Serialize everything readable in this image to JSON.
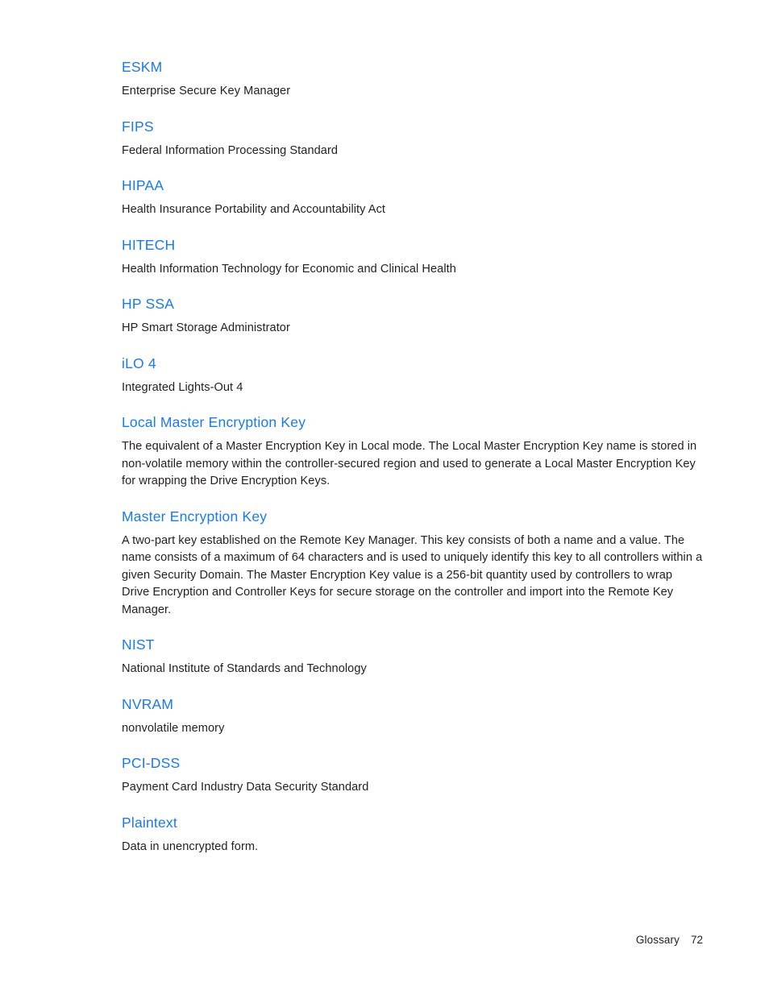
{
  "document": {
    "section_title": "Glossary",
    "page_number": "72",
    "heading_color": "#1a7ae8",
    "body_color": "#231f20",
    "background_color": "#ffffff"
  },
  "glossary": {
    "entries": [
      {
        "term": "ESKM",
        "definition": "Enterprise Secure Key Manager"
      },
      {
        "term": "FIPS",
        "definition": "Federal Information Processing Standard"
      },
      {
        "term": "HIPAA",
        "definition": "Health Insurance Portability and Accountability Act"
      },
      {
        "term": "HITECH",
        "definition": "Health Information Technology for Economic and Clinical Health"
      },
      {
        "term": "HP SSA",
        "definition": "HP Smart Storage Administrator"
      },
      {
        "term": "iLO 4",
        "definition": "Integrated Lights-Out 4"
      },
      {
        "term": "Local Master Encryption Key",
        "definition": "The equivalent of a Master Encryption Key in Local mode. The Local Master Encryption Key name is stored in non-volatile memory within the controller-secured region and used to generate a Local Master Encryption Key for wrapping the Drive Encryption Keys."
      },
      {
        "term": "Master Encryption Key",
        "definition": "A two-part key established on the Remote Key Manager. This key consists of both a name and a value. The name consists of a maximum of 64 characters and is used to uniquely identify this key to all controllers within a given Security Domain. The Master Encryption Key value is a 256-bit quantity used by controllers to wrap Drive Encryption and Controller Keys for secure storage on the controller and import into the Remote Key Manager."
      },
      {
        "term": "NIST",
        "definition": "National Institute of Standards and Technology"
      },
      {
        "term": "NVRAM",
        "definition": "nonvolatile memory"
      },
      {
        "term": "PCI-DSS",
        "definition": "Payment Card Industry Data Security Standard"
      },
      {
        "term": "Plaintext",
        "definition": "Data in unencrypted form."
      }
    ]
  }
}
